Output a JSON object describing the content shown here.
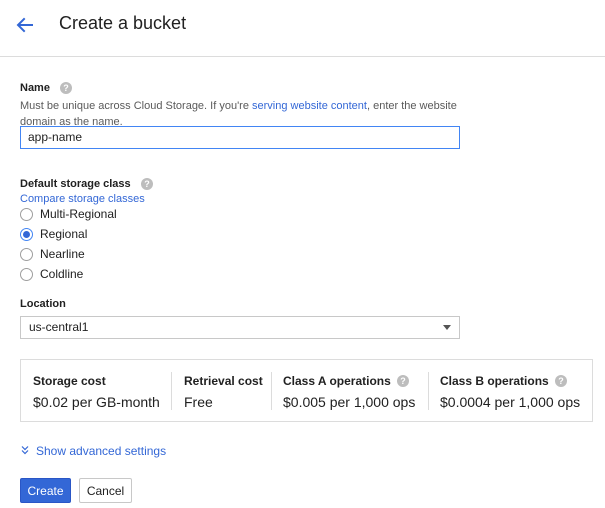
{
  "header": {
    "title": "Create a bucket"
  },
  "name": {
    "label": "Name",
    "desc_before": "Must be unique across Cloud Storage. If you're ",
    "desc_link": "serving website content",
    "desc_after": ", enter the website domain as the name.",
    "value": "app-name"
  },
  "storage_class": {
    "label": "Default storage class",
    "compare_link": "Compare storage classes",
    "options": [
      "Multi-Regional",
      "Regional",
      "Nearline",
      "Coldline"
    ],
    "selected": "Regional"
  },
  "location": {
    "label": "Location",
    "value": "us-central1"
  },
  "costs": [
    {
      "head": "Storage cost",
      "value": "$0.02 per GB-month"
    },
    {
      "head": "Retrieval cost",
      "value": "Free"
    },
    {
      "head": "Class A operations",
      "value": "$0.005 per 1,000 ops"
    },
    {
      "head": "Class B operations",
      "value": "$0.0004 per 1,000 ops"
    }
  ],
  "advanced": {
    "label": "Show advanced settings"
  },
  "actions": {
    "create": "Create",
    "cancel": "Cancel"
  },
  "colors": {
    "accent": "#3367d6",
    "border": "#dcdcdc",
    "text": "#212121"
  }
}
